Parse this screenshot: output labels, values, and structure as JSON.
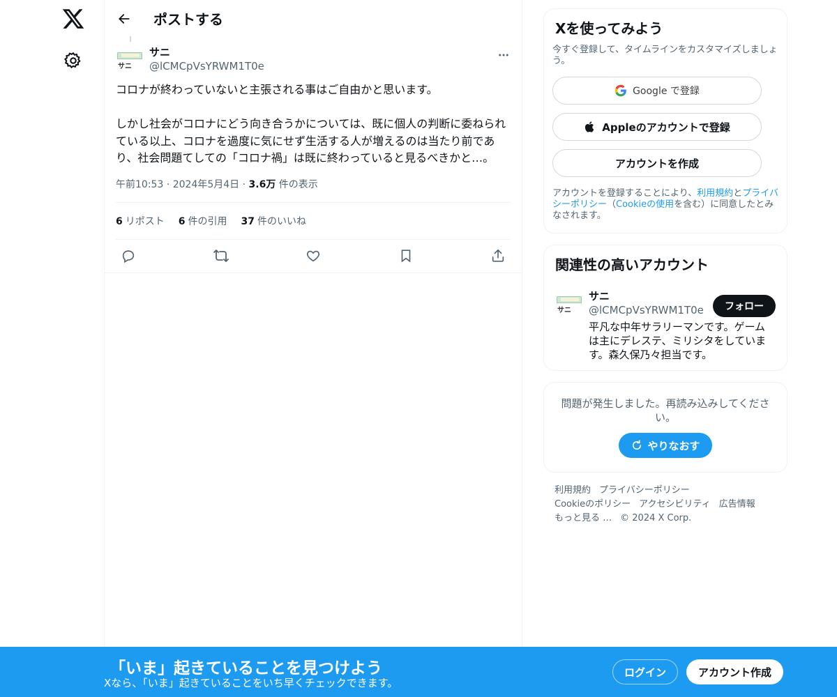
{
  "nav": {
    "logo_icon": "x-logo-icon",
    "settings_icon": "gear-icon"
  },
  "header": {
    "title": "ポストする"
  },
  "post": {
    "author_name": "サニ",
    "author_handle": "@lCMCpVsYRWM1T0e",
    "avatar_text": "サニ",
    "text": "コロナが終わっていないと主張される事はご自由かと思います。\n\nしかし社会がコロナにどう向き合うかについては、既に個人の判断に委ねられている以上、コロナを過度に気にせず生活する人が増えるのは当たり前であり、社会問題てしての「コロナ禍」は既に終わっていると見るべきかと…。",
    "time": "午前10:53",
    "date": "2024年5月4日",
    "views_count": "3.6万",
    "views_label": "件の表示",
    "separator": "·",
    "stats": [
      {
        "count": "6",
        "label": "リポスト"
      },
      {
        "count": "6",
        "label": "件の引用"
      },
      {
        "count": "37",
        "label": "件のいいね"
      }
    ]
  },
  "signup": {
    "title": "Xを使ってみよう",
    "subtitle": "今すぐ登録して、タイムラインをカスタマイズしましょう。",
    "google_label": "Google で登録",
    "apple_label": "Appleのアカウントで登録",
    "create_label": "アカウントを作成",
    "terms_prefix": "アカウントを登録することにより、",
    "terms_link1": "利用規約",
    "terms_and": "と",
    "terms_link2": "プライバシーポリシー",
    "terms_mid": "（",
    "terms_link3": "Cookieの使用",
    "terms_suffix": "を含む）に同意したとみなされます。"
  },
  "related": {
    "title": "関連性の高いアカウント",
    "name": "サニ",
    "handle": "@lCMCpVsYRWM1T0e",
    "bio": "平凡な中年サラリーマンです。ゲームは主にデレステ、ミリシタをしています。森久保乃々担当です。",
    "follow_label": "フォロー"
  },
  "error": {
    "message": "問題が発生しました。再読み込みしてください。",
    "retry_label": "やりなおす"
  },
  "footer": {
    "links": [
      "利用規約",
      "プライバシーポリシー",
      "Cookieのポリシー",
      "アクセシビリティ",
      "広告情報",
      "もっと見る …",
      "© 2024 X Corp."
    ]
  },
  "bottombar": {
    "title": "「いま」起きていることを見つけよう",
    "subtitle": "Xなら、「いま」起きていることをいち早くチェックできます。",
    "login_label": "ログイン",
    "signup_label": "アカウント作成"
  },
  "colors": {
    "accent": "#1d9bf0",
    "text": "#0f1419",
    "muted": "#536471",
    "border": "#eff3f4"
  }
}
